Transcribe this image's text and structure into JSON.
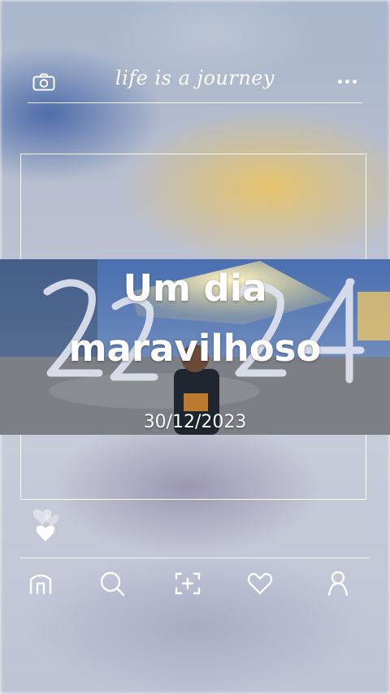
{
  "header": {
    "title": "life is a journey"
  },
  "post": {
    "headline_line1": "Um dia",
    "headline_line2": "maravilhoso",
    "date": "30/12/2023"
  },
  "icons": {
    "top_left": "camera-icon",
    "top_right": "more-dots-icon",
    "nav": [
      "home-icon",
      "search-icon",
      "scan-add-icon",
      "heart-icon",
      "profile-icon"
    ],
    "reaction": "heart-icon"
  },
  "colors": {
    "line": "#ffffff",
    "glow": "#f2dfa0"
  }
}
